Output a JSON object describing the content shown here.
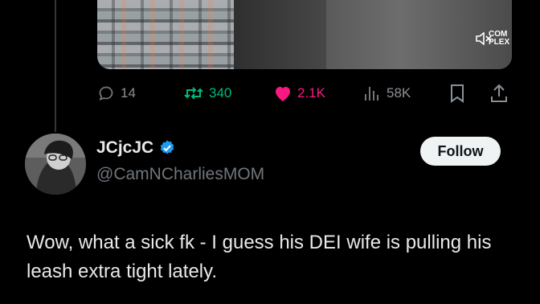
{
  "media": {
    "brand_label": "COM PLEX",
    "mute_icon": "speaker-muted-icon"
  },
  "actions": {
    "replies": "14",
    "reposts": "340",
    "likes": "2.1K",
    "views": "58K",
    "colors": {
      "repost": "#00ba7c",
      "like": "#f91880",
      "default": "#71767b"
    },
    "icons": [
      "reply-icon",
      "repost-icon",
      "heart-icon",
      "views-icon",
      "bookmark-icon",
      "share-icon"
    ]
  },
  "reply": {
    "display_name": "JCjcJC",
    "handle": "@CamNCharliesMOM",
    "verified_color": "#1d9bf0",
    "follow_label": "Follow",
    "text": "Wow, what a sick fk - I guess his DEI wife is pulling his leash extra tight lately."
  }
}
